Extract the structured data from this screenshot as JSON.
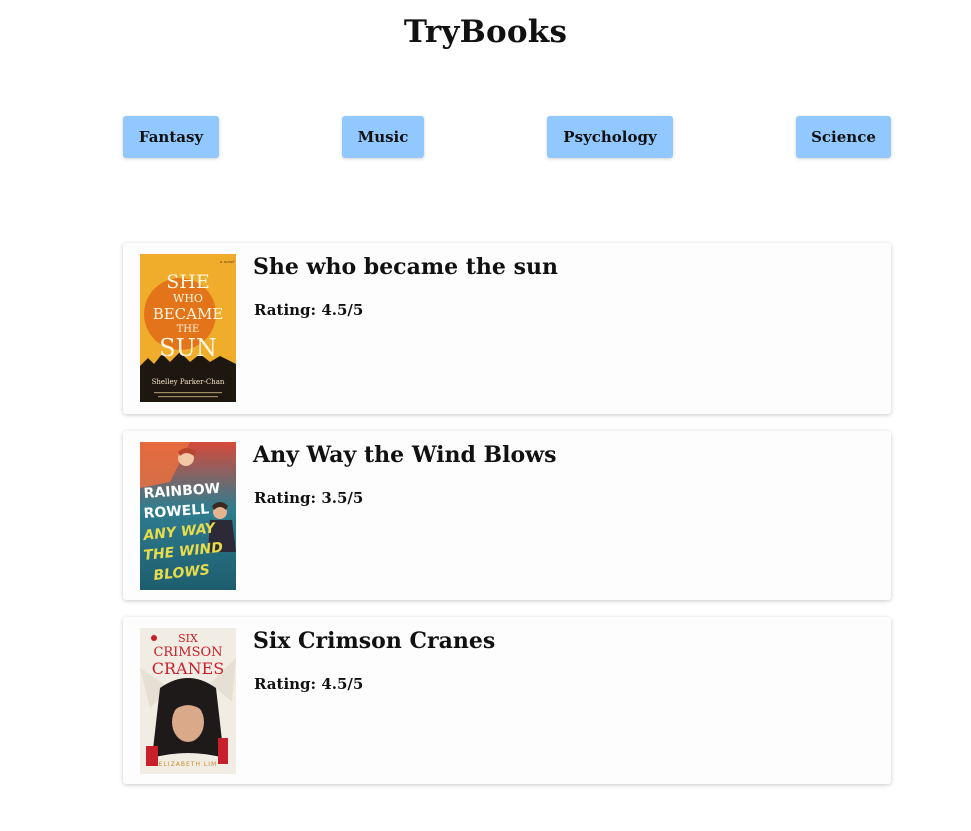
{
  "site": {
    "title": "TryBooks"
  },
  "categories": [
    {
      "label": "Fantasy"
    },
    {
      "label": "Music"
    },
    {
      "label": "Psychology"
    },
    {
      "label": "Science"
    }
  ],
  "books": [
    {
      "title": "She who became the sun",
      "rating_label": "Rating:",
      "rating": "4.5/5",
      "cover": {
        "tag": "a novel",
        "title_lines": [
          "SHE",
          "WHO",
          "BECAME",
          "THE",
          "SUN"
        ],
        "author": "Shelley Parker-Chan",
        "colors": {
          "bg": "#f0ad2c",
          "sun": "#e3741a",
          "text": "#fff6df"
        }
      }
    },
    {
      "title": "Any Way the Wind Blows",
      "rating_label": "Rating:",
      "rating": "3.5/5",
      "cover": {
        "author_lines": [
          "RAINBOW",
          "ROWELL"
        ],
        "title_lines": [
          "ANY WAY",
          "THE WIND",
          "BLOWS"
        ],
        "colors": {
          "bg_top": "#d64a3a",
          "bg_bottom": "#1d5d6e",
          "author": "#ffffff",
          "title": "#e8dc4a"
        }
      }
    },
    {
      "title": "Six Crimson Cranes",
      "rating_label": "Rating:",
      "rating": "4.5/5",
      "cover": {
        "title_lines": [
          "SIX",
          "CRIMSON",
          "CRANES"
        ],
        "author": "ELIZABETH LIM",
        "colors": {
          "bg": "#f2ede4",
          "title": "#c8202a",
          "hair": "#1e1a1a"
        }
      }
    }
  ]
}
